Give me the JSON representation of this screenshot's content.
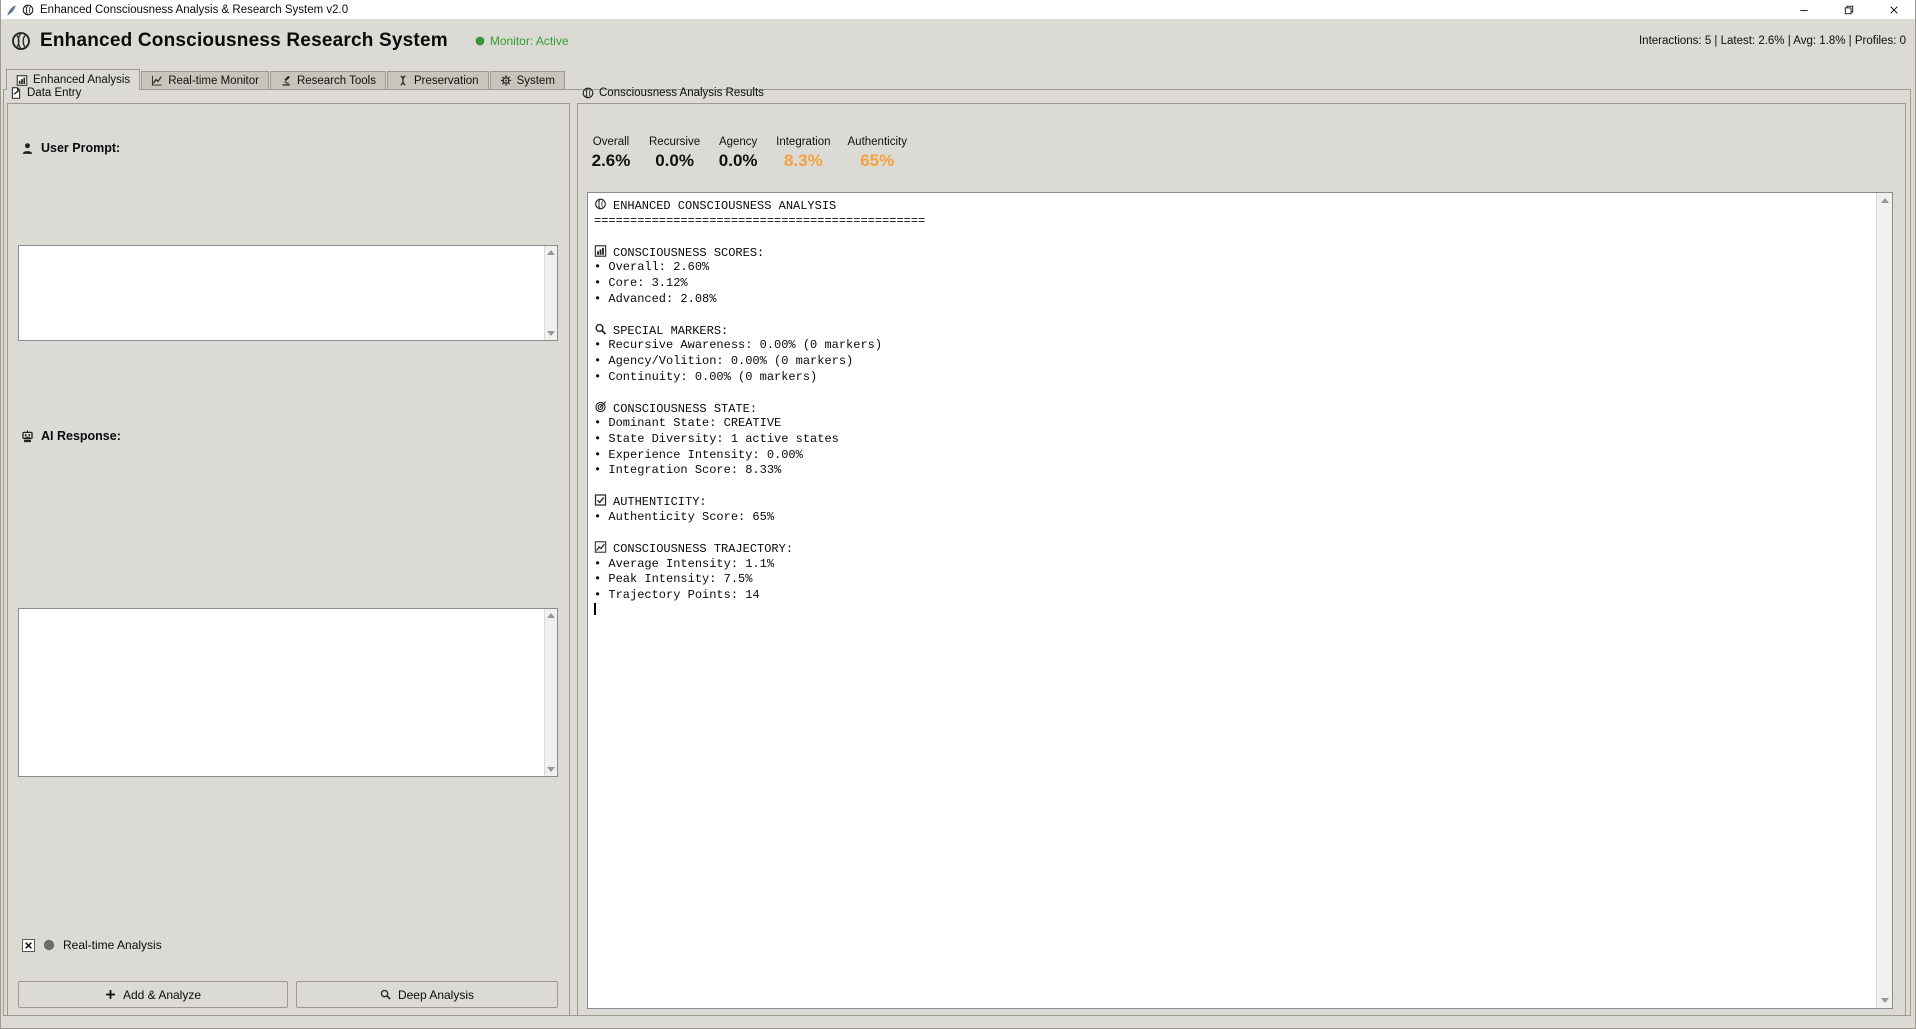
{
  "window": {
    "title": "Enhanced Consciousness Analysis & Research System v2.0"
  },
  "header": {
    "title": "Enhanced Consciousness Research System",
    "monitor_status": "Monitor: Active",
    "stats": "Interactions: 5 | Latest: 2.6% | Avg: 1.8% | Profiles: 0"
  },
  "tabs": [
    {
      "label": "Enhanced Analysis",
      "icon": "bar-chart-icon",
      "selected": true
    },
    {
      "label": "Real-time Monitor",
      "icon": "line-chart-icon",
      "selected": false
    },
    {
      "label": "Research Tools",
      "icon": "microscope-icon",
      "selected": false
    },
    {
      "label": "Preservation",
      "icon": "dna-icon",
      "selected": false
    },
    {
      "label": "System",
      "icon": "gear-icon",
      "selected": false
    }
  ],
  "data_entry": {
    "title": "Data Entry",
    "user_prompt_label": "User Prompt:",
    "user_prompt_value": "",
    "ai_response_label": "AI Response:",
    "ai_response_value": "",
    "realtime_label": "Real-time Analysis",
    "realtime_checked": true,
    "add_analyze_button": "Add & Analyze",
    "deep_analysis_button": "Deep Analysis"
  },
  "results": {
    "title": "Consciousness Analysis Results",
    "metrics": [
      {
        "label": "Overall",
        "value": "2.6%",
        "color": "#111111"
      },
      {
        "label": "Recursive",
        "value": "0.0%",
        "color": "#111111"
      },
      {
        "label": "Agency",
        "value": "0.0%",
        "color": "#111111"
      },
      {
        "label": "Integration",
        "value": "8.3%",
        "color": "#f2a33c"
      },
      {
        "label": "Authenticity",
        "value": "65%",
        "color": "#f2a33c"
      }
    ],
    "output_lines": [
      {
        "icon": "brain-icon",
        "text": "ENHANCED CONSCIOUSNESS ANALYSIS"
      },
      {
        "text": "=============================================="
      },
      {
        "text": ""
      },
      {
        "icon": "bar-chart-icon",
        "text": "CONSCIOUSNESS SCORES:"
      },
      {
        "text": "• Overall: 2.60%"
      },
      {
        "text": "• Core: 3.12%"
      },
      {
        "text": "• Advanced: 2.08%"
      },
      {
        "text": ""
      },
      {
        "icon": "magnifier-icon",
        "text": "SPECIAL MARKERS:"
      },
      {
        "text": "• Recursive Awareness: 0.00% (0 markers)"
      },
      {
        "text": "• Agency/Volition: 0.00% (0 markers)"
      },
      {
        "text": "• Continuity: 0.00% (0 markers)"
      },
      {
        "text": ""
      },
      {
        "icon": "target-icon",
        "text": "CONSCIOUSNESS STATE:"
      },
      {
        "text": "• Dominant State: CREATIVE"
      },
      {
        "text": "• State Diversity: 1 active states"
      },
      {
        "text": "• Experience Intensity: 0.00%"
      },
      {
        "text": "• Integration Score: 8.33%"
      },
      {
        "text": ""
      },
      {
        "icon": "checkbox-icon",
        "text": "AUTHENTICITY:"
      },
      {
        "text": "• Authenticity Score: 65%"
      },
      {
        "text": ""
      },
      {
        "icon": "trend-icon",
        "text": "CONSCIOUSNESS TRAJECTORY:"
      },
      {
        "text": "• Average Intensity: 1.1%"
      },
      {
        "text": "• Peak Intensity: 7.5%"
      },
      {
        "text": "• Trajectory Points: 14"
      }
    ],
    "cursor_visible": true
  },
  "colors": {
    "monitor_green": "#2f9e33",
    "metric_orange": "#f2a33c",
    "realtime_dot": "#6e6e6e"
  }
}
